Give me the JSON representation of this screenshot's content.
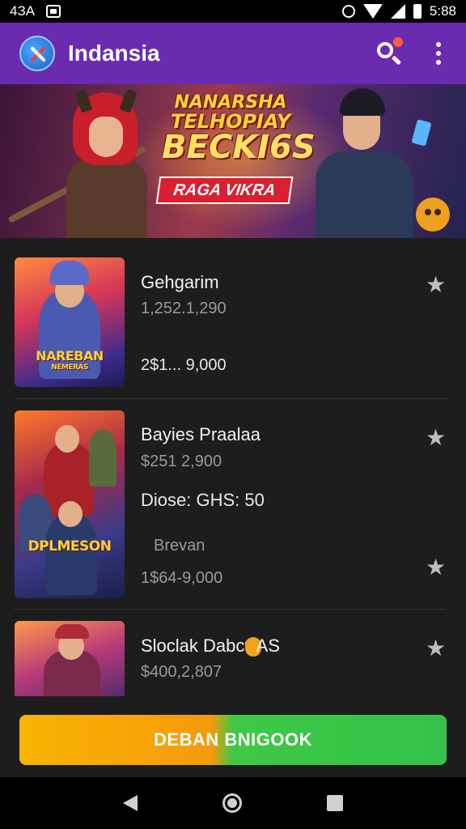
{
  "status_bar": {
    "left_text": "4ЗA",
    "time": "5:88"
  },
  "app_bar": {
    "title": "Indansia",
    "icons": [
      "app-logo",
      "search-icon",
      "more-vert-icon"
    ]
  },
  "banner": {
    "title_line1": "NANARSHA",
    "title_line2": "TELHOPIAY",
    "title_line3": "BECKI6S",
    "ribbon": "RAGA VIKRA"
  },
  "items": [
    {
      "title": "Gehgarim",
      "line1": "1,252.1,290",
      "line2": "2$1... 9,000",
      "thumb_label_line1": "NAREBAN",
      "thumb_label_line2": "NEMERAS"
    },
    {
      "title": "Bayies Praalaa",
      "line1": "$251 2,900",
      "line2": "Diose: GHS: 50",
      "line3": "Brevan",
      "line4": "1$64-9,000",
      "thumb_label": "DPLMESON"
    },
    {
      "title_part1": "Sloclak Dabct",
      "title_part2": "AS",
      "line1": "$400,2,807"
    }
  ],
  "cta": {
    "label": "DEBAN BNIGOOK",
    "colors": [
      "#f8b400",
      "#34c24a"
    ]
  },
  "nav_bar": {
    "icons": [
      "back-icon",
      "home-icon",
      "recents-icon"
    ]
  },
  "colors": {
    "app_bar": "#6a2bb0",
    "background": "#1d1d1d"
  }
}
